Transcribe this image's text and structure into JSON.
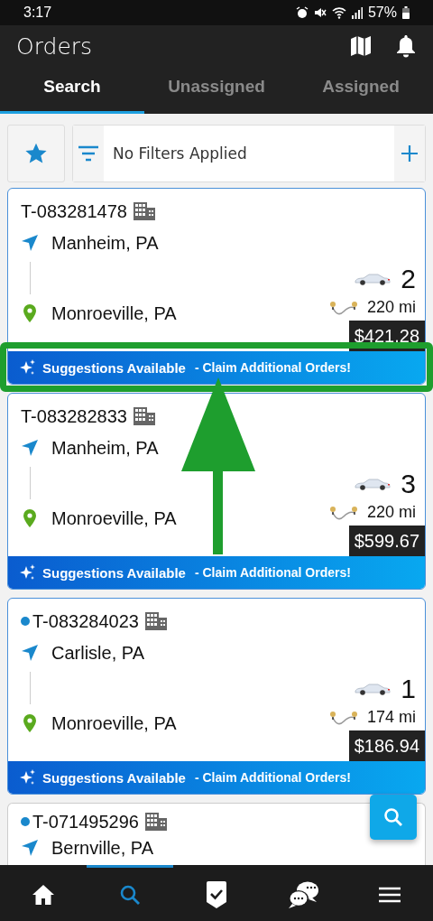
{
  "status_bar": {
    "time": "3:17",
    "battery": "57%"
  },
  "header": {
    "title": "Orders"
  },
  "tabs": [
    {
      "label": "Search",
      "selected": true
    },
    {
      "label": "Unassigned",
      "selected": false
    },
    {
      "label": "Assigned",
      "selected": false
    }
  ],
  "filter": {
    "text": "No Filters Applied"
  },
  "orders": [
    {
      "id": "T-083281478",
      "unread": false,
      "pickup": "Manheim, PA",
      "dropoff": "Monroeville, PA",
      "vehicles": "2",
      "distance": "220 mi",
      "price": "$421.28",
      "suggestion": {
        "title": "Suggestions Available",
        "text": "- Claim Additional Orders!"
      },
      "highlighted": true
    },
    {
      "id": "T-083282833",
      "unread": false,
      "pickup": "Manheim, PA",
      "dropoff": "Monroeville, PA",
      "vehicles": "3",
      "distance": "220 mi",
      "price": "$599.67",
      "suggestion": {
        "title": "Suggestions Available",
        "text": "- Claim Additional Orders!"
      },
      "highlighted": false
    },
    {
      "id": "T-083284023",
      "unread": true,
      "pickup": "Carlisle, PA",
      "dropoff": "Monroeville, PA",
      "vehicles": "1",
      "distance": "174 mi",
      "price": "$186.94",
      "suggestion": {
        "title": "Suggestions Available",
        "text": "- Claim Additional Orders!"
      },
      "highlighted": false
    },
    {
      "id": "T-071495296",
      "unread": true,
      "pickup": "Bernville, PA"
    }
  ],
  "annotation_arrow": true,
  "nav": [
    {
      "kind": "home",
      "selected": false
    },
    {
      "kind": "search",
      "selected": true
    },
    {
      "kind": "tasks",
      "selected": false
    },
    {
      "kind": "chat",
      "selected": false
    },
    {
      "kind": "menu",
      "selected": false
    }
  ]
}
